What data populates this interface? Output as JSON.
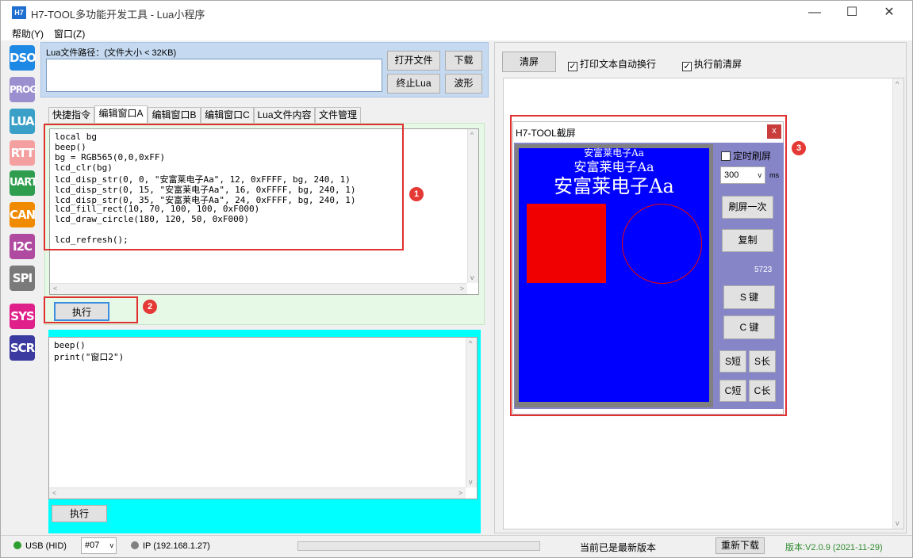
{
  "window": {
    "title": "H7-TOOL多功能开发工具 - Lua小程序",
    "icon_text": "H7",
    "controls": [
      "—",
      "☐",
      "✕"
    ]
  },
  "menu": [
    "帮助(Y)",
    "窗口(Z)"
  ],
  "tools": [
    {
      "label": "DSO",
      "color": "#1e88e5"
    },
    {
      "label": "PROG",
      "color": "#9c8fd0"
    },
    {
      "label": "LUA",
      "color": "#3aa0c8"
    },
    {
      "label": "RTT",
      "color": "#f4a0a0"
    },
    {
      "label": "UART",
      "color": "#2e9e4e"
    },
    {
      "label": "CAN",
      "color": "#f08a00"
    },
    {
      "label": "I2C",
      "color": "#b04aa0"
    },
    {
      "label": "SPI",
      "color": "#7a7a7a"
    },
    {
      "label": "SYS",
      "color": "#e0208a"
    },
    {
      "label": "SCR",
      "color": "#3a3aa0"
    }
  ],
  "lua_path": {
    "label": "Lua文件路径：(文件大小 < 32KB)",
    "value": "",
    "buttons": {
      "open": "打开文件",
      "download": "下载",
      "stop": "终止Lua",
      "wave": "波形"
    }
  },
  "tabs": [
    "快捷指令",
    "编辑窗口A",
    "编辑窗口B",
    "编辑窗口C",
    "Lua文件内容",
    "文件管理"
  ],
  "editor_a": {
    "code": [
      "local bg",
      "beep()",
      "bg = RGB565(0,0,0xFF)",
      "lcd_clr(bg)",
      "lcd_disp_str(0, 0, \"安富莱电子Aa\", 12, 0xFFFF, bg, 240, 1)",
      "lcd_disp_str(0, 15, \"安富莱电子Aa\", 16, 0xFFFF, bg, 240, 1)",
      "lcd_disp_str(0, 35, \"安富莱电子Aa\", 24, 0xFFFF, bg, 240, 1)",
      "lcd_fill_rect(10, 70, 100, 100, 0xF000)",
      "lcd_draw_circle(180, 120, 50, 0xF000)",
      "",
      "lcd_refresh();"
    ],
    "run_label": "执行"
  },
  "editor_2": {
    "code": [
      "beep()",
      "print(\"窗口2\")"
    ],
    "run_label": "执行"
  },
  "output": {
    "clear_label": "清屏",
    "wrap_label": "打印文本自动换行",
    "wrap_checked": true,
    "clear_before_label": "执行前清屏",
    "clear_before_checked": true
  },
  "capture": {
    "title": "H7-TOOL截屏",
    "close": "x",
    "timer_label": "定时刷屏",
    "timer_checked": false,
    "interval": "300",
    "unit": "ms",
    "refresh_once": "刷屏一次",
    "copy": "复制",
    "counter": "5723",
    "s_key": "S  键",
    "c_key": "C  键",
    "s_short": "S短",
    "s_long": "S长",
    "c_short": "C短",
    "c_long": "C长",
    "lcd": {
      "background": "#0000ff",
      "lines": [
        "安富莱电子Aa",
        "安富莱电子Aa",
        "安富莱电子Aa"
      ],
      "fill_color": "#f00000"
    }
  },
  "badges": [
    "1",
    "2",
    "3"
  ],
  "status": {
    "usb": "USB (HID)",
    "usb_color": "#2e9e2e",
    "port": "#07",
    "ip": "IP (192.168.1.27)",
    "ip_color": "#808080",
    "update_msg": "当前已是最新版本",
    "redownload": "重新下载",
    "version": "版本:V2.0.9 (2021-11-29)",
    "version_color": "#2e8b2e"
  }
}
